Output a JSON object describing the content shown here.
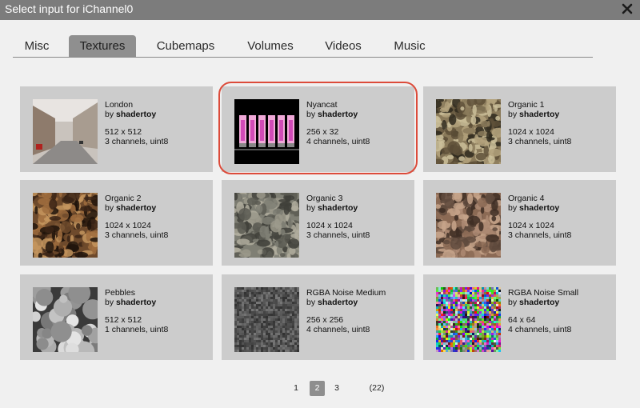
{
  "dialog": {
    "title": "Select input for iChannel0"
  },
  "tabs": [
    {
      "label": "Misc"
    },
    {
      "label": "Textures"
    },
    {
      "label": "Cubemaps"
    },
    {
      "label": "Volumes"
    },
    {
      "label": "Videos"
    },
    {
      "label": "Music"
    }
  ],
  "active_tab": "Textures",
  "items": [
    {
      "name": "London",
      "by_prefix": "by",
      "author": "shadertoy",
      "resolution": "512 x 512",
      "format": "3 channels, uint8"
    },
    {
      "name": "Nyancat",
      "by_prefix": "by",
      "author": "shadertoy",
      "resolution": "256 x 32",
      "format": "4 channels, uint8"
    },
    {
      "name": "Organic 1",
      "by_prefix": "by",
      "author": "shadertoy",
      "resolution": "1024 x 1024",
      "format": "3 channels, uint8"
    },
    {
      "name": "Organic 2",
      "by_prefix": "by",
      "author": "shadertoy",
      "resolution": "1024 x 1024",
      "format": "3 channels, uint8"
    },
    {
      "name": "Organic 3",
      "by_prefix": "by",
      "author": "shadertoy",
      "resolution": "1024 x 1024",
      "format": "3 channels, uint8"
    },
    {
      "name": "Organic 4",
      "by_prefix": "by",
      "author": "shadertoy",
      "resolution": "1024 x 1024",
      "format": "3 channels, uint8"
    },
    {
      "name": "Pebbles",
      "by_prefix": "by",
      "author": "shadertoy",
      "resolution": "512 x 512",
      "format": "1 channels, uint8"
    },
    {
      "name": "RGBA Noise Medium",
      "by_prefix": "by",
      "author": "shadertoy",
      "resolution": "256 x 256",
      "format": "4 channels, uint8"
    },
    {
      "name": "RGBA Noise Small",
      "by_prefix": "by",
      "author": "shadertoy",
      "resolution": "64 x 64",
      "format": "4 channels, uint8"
    }
  ],
  "selected_item": "Nyancat",
  "pagination": {
    "pages": [
      "1",
      "2",
      "3"
    ],
    "current": "2",
    "total": "(22)"
  },
  "icons": {
    "close": "close-icon"
  },
  "colors": {
    "selection_ring": "#dc4b3a",
    "titlebar": "#7c7c7c",
    "active_tab": "#8f8f8f"
  }
}
